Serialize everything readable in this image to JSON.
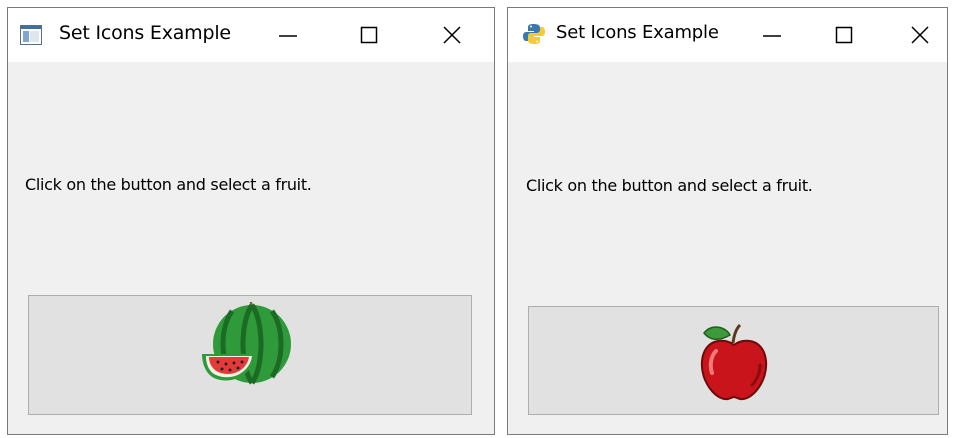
{
  "windows": [
    {
      "title": "Set Icons Example",
      "app_icon": "window-app-icon",
      "controls": [
        "minimize-icon",
        "maximize-icon",
        "close-icon"
      ],
      "prompt": "Click on the button and select a fruit.",
      "button_icon": "watermelon-icon"
    },
    {
      "title": "Set Icons Example",
      "app_icon": "python-logo-icon",
      "controls": [
        "minimize-icon",
        "maximize-icon",
        "close-icon"
      ],
      "prompt": "Click on the button and select a fruit.",
      "button_icon": "apple-icon"
    }
  ],
  "colors": {
    "window_bg": "#f0f0f0",
    "titlebar_bg": "#ffffff",
    "button_bg": "#e1e1e1",
    "button_border": "#adadad"
  }
}
